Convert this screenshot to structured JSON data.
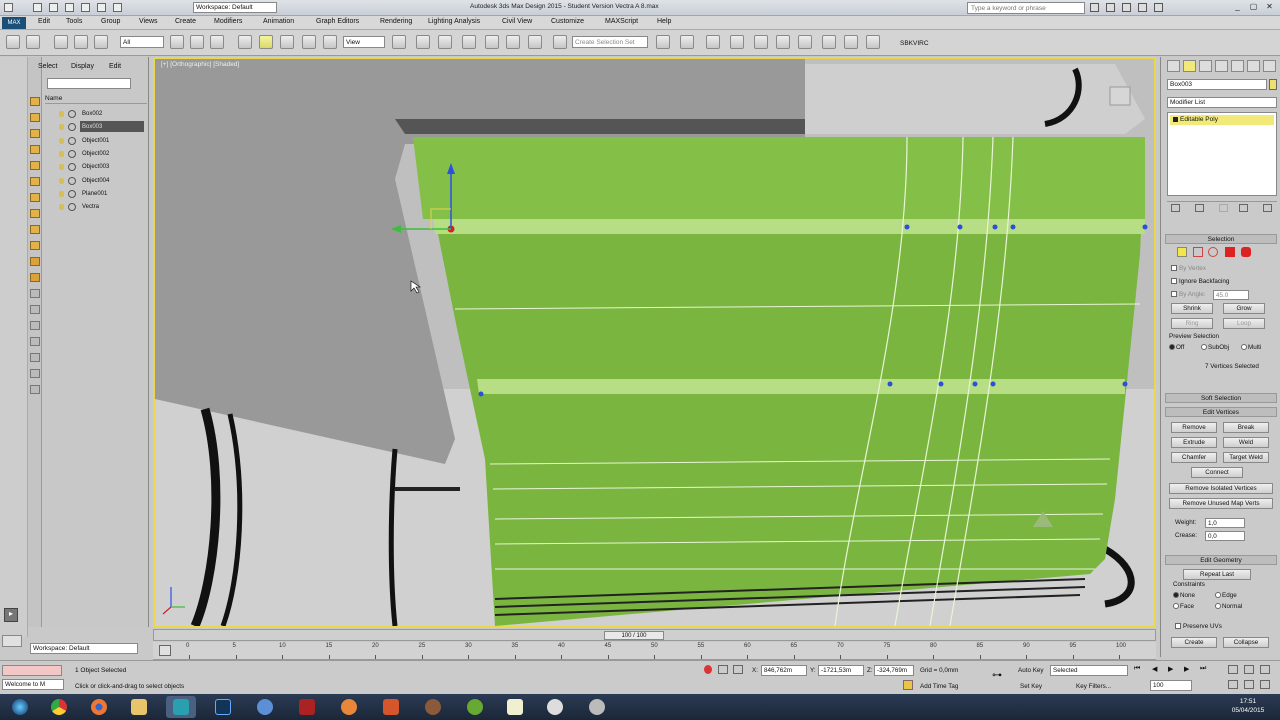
{
  "window": {
    "title": "Autodesk 3ds Max Design 2015 - Student Version   Vectra A 8.max",
    "workspace": "Workspace: Default",
    "search_placeholder": "Type a keyword or phrase"
  },
  "menu": {
    "app_button": "MAX",
    "items": [
      "Edit",
      "Tools",
      "Group",
      "Views",
      "Create",
      "Modifiers",
      "Animation",
      "Graph Editors",
      "Rendering",
      "Lighting Analysis",
      "Civil View",
      "Customize",
      "MAXScript",
      "Help"
    ]
  },
  "toolbar": {
    "selection_filter": "All",
    "ref_coord": "View",
    "named_sel_placeholder": "Create Selection Set",
    "render_label": "SBKVIRC"
  },
  "explorer": {
    "tabs": [
      "Select",
      "Display",
      "Edit"
    ],
    "column_header": "Name",
    "objects": [
      {
        "name": "Box002",
        "selected": false
      },
      {
        "name": "Box003",
        "selected": true
      },
      {
        "name": "Object001",
        "selected": false
      },
      {
        "name": "Object002",
        "selected": false
      },
      {
        "name": "Object003",
        "selected": false
      },
      {
        "name": "Object004",
        "selected": false
      },
      {
        "name": "Plane001",
        "selected": false
      },
      {
        "name": "Vectra",
        "selected": false
      }
    ],
    "workspace_bottom": "Workspace: Default"
  },
  "viewport": {
    "label": "[+] [Orthographic] [Shaded]"
  },
  "command_panel": {
    "object_name": "Box003",
    "object_color": "#f0e070",
    "modifier_list": "Modifier List",
    "stack_item": "Editable Poly",
    "selection": {
      "title": "Selection",
      "by_vertex": "By Vertex",
      "ignore_backfacing": "Ignore Backfacing",
      "by_angle": "By Angle:",
      "by_angle_value": "45.0",
      "shrink": "Shrink",
      "grow": "Grow",
      "ring": "Ring",
      "loop": "Loop",
      "preview_selection": "Preview Selection",
      "preview_off": "Off",
      "preview_subobj": "SubObj",
      "preview_multi": "Multi",
      "status": "7 Vertices Selected"
    },
    "soft_selection": "Soft Selection",
    "edit_vertices": {
      "title": "Edit Vertices",
      "remove": "Remove",
      "break": "Break",
      "extrude": "Extrude",
      "weld": "Weld",
      "chamfer": "Chamfer",
      "target_weld": "Target Weld",
      "connect": "Connect",
      "remove_isolated": "Remove Isolated Vertices",
      "remove_unused": "Remove Unused Map Verts",
      "weight_label": "Weight:",
      "weight_value": "1,0",
      "crease_label": "Crease:",
      "crease_value": "0,0"
    },
    "edit_geometry": {
      "title": "Edit Geometry",
      "repeat_last": "Repeat Last",
      "constraints": "Constraints",
      "none": "None",
      "edge": "Edge",
      "face": "Face",
      "normal": "Normal",
      "preserve_uvs": "Preserve UVs",
      "create": "Create",
      "collapse": "Collapse"
    }
  },
  "timeline": {
    "frame": "100 / 100",
    "ticks": [
      "0",
      "5",
      "10",
      "15",
      "20",
      "25",
      "30",
      "35",
      "40",
      "45",
      "50",
      "55",
      "60",
      "65",
      "70",
      "75",
      "80",
      "85",
      "90",
      "95",
      "100"
    ]
  },
  "status": {
    "maxscript": "Welcome to M",
    "selected": "1 Object Selected",
    "prompt": "Click or click-and-drag to select objects",
    "x_label": "X:",
    "x": "846,762m",
    "y_label": "Y:",
    "y": "-1721,53m",
    "z_label": "Z:",
    "z": "-324,769m",
    "grid": "Grid = 0,0mm",
    "add_time_tag": "Add Time Tag",
    "auto_key": "Auto Key",
    "key_mode": "Selected",
    "set_key": "Set Key",
    "key_filters": "Key Filters...",
    "current_frame": "100"
  },
  "taskbar": {
    "time": "17:51",
    "date": "05/04/2015"
  }
}
